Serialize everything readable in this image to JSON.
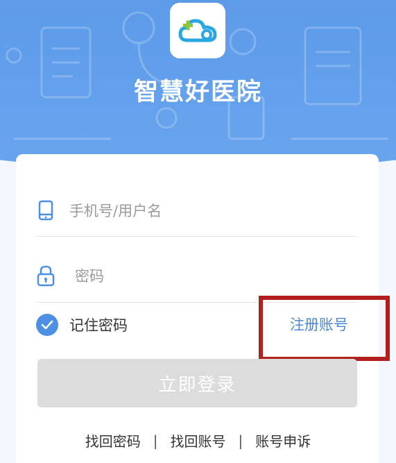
{
  "app": {
    "title": "智慧好医院"
  },
  "login": {
    "username_placeholder": "手机号/用户名",
    "password_placeholder": "密码",
    "remember_label": "记住密码",
    "remember_checked": true,
    "register_label": "注册账号",
    "submit_label": "立即登录"
  },
  "footer": {
    "links": [
      "找回密码",
      "找回账号",
      "账号申诉"
    ],
    "separator": "|"
  },
  "colors": {
    "header_blue": "#5d9ae8",
    "accent_blue": "#4d8fe3",
    "link_blue": "#4a87d5",
    "logo_teal": "#2aa7df",
    "logo_green": "#8cc63f",
    "highlight_red": "#b31f1f",
    "button_disabled": "#dcdcdc"
  },
  "icons": {
    "logo": "cloud-plus-icon",
    "username": "phone-icon",
    "password": "lock-icon",
    "remember": "check-circle-icon"
  }
}
